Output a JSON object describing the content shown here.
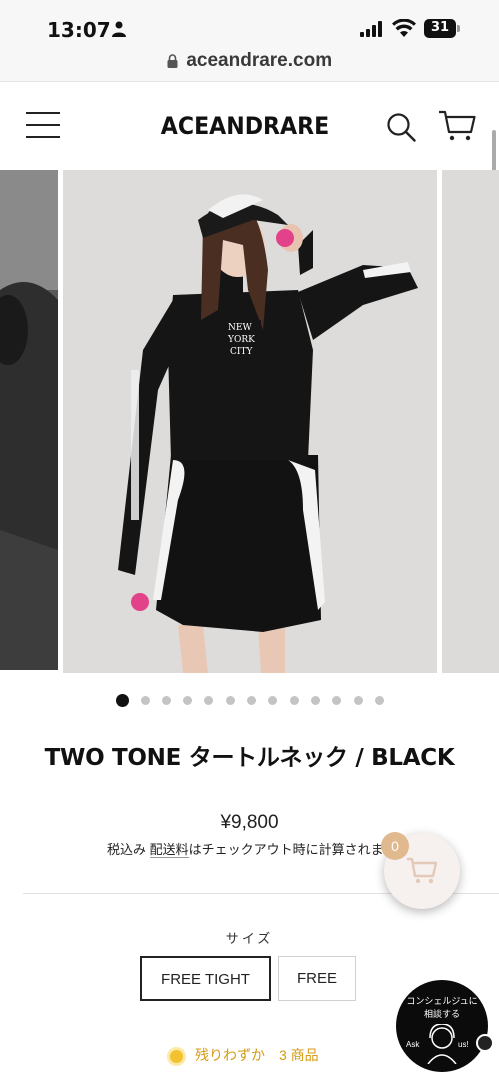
{
  "status_bar": {
    "time": "13:07",
    "battery": "31"
  },
  "browser": {
    "url": "aceandrare.com"
  },
  "header": {
    "logo": "ACEANDRARE"
  },
  "gallery": {
    "total_slides": 13,
    "active_slide": 1
  },
  "product": {
    "title": "TWO TONE タートルネック / BLACK",
    "price": "¥9,800",
    "tax_included": "税込み",
    "shipping_link": "配送料",
    "shipping_note": "はチェックアウト時に計算されます"
  },
  "size": {
    "label": "サイズ",
    "options": [
      "FREE TIGHT",
      "FREE"
    ],
    "selected": "FREE TIGHT"
  },
  "stock": {
    "text": "残りわずか　3 商品"
  },
  "floating_cart": {
    "count": "0"
  },
  "concierge": {
    "line1": "コンシェルジュに",
    "line2": "相談する",
    "ask": "Ask",
    "us": "us!"
  }
}
